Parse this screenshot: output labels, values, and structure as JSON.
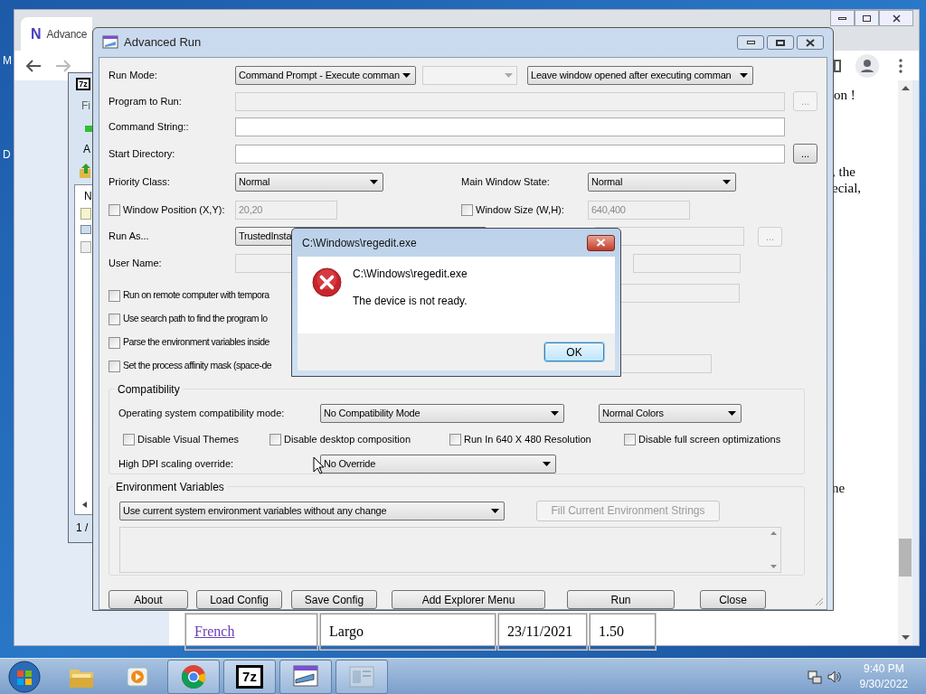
{
  "desktop": {
    "icon_labels": [
      "M",
      "D"
    ]
  },
  "browser": {
    "tab": {
      "favicon": "N",
      "title": "Advance"
    },
    "page_texts": [
      "on !",
      ", the",
      "ecial,",
      "ne"
    ],
    "table_row": [
      {
        "text": "French",
        "kind": "link"
      },
      {
        "text": "Largo",
        "kind": "text"
      },
      {
        "text": "23/11/2021",
        "kind": "text"
      },
      {
        "text": "1.50",
        "kind": "text"
      }
    ]
  },
  "archive_window": {
    "logo": "7z",
    "menu": "Fi",
    "toolbar_label": "A",
    "column_header": "N",
    "status": "1 /"
  },
  "main_window": {
    "title": "Advanced Run",
    "run_mode": {
      "label": "Run Mode:",
      "mode": "Command Prompt - Execute comman",
      "window_option": "Leave window opened after executing comman"
    },
    "program_to_run": {
      "label": "Program to Run:",
      "disabled": true,
      "browse": "...",
      "browse_disabled": true
    },
    "command_string": {
      "label": "Command String::"
    },
    "start_directory": {
      "label": "Start Directory:",
      "browse": "...",
      "browse_disabled": false
    },
    "priority_class": {
      "label": "Priority Class:",
      "value": "Normal"
    },
    "main_window_state": {
      "label": "Main Window State:",
      "value": "Normal"
    },
    "window_position": {
      "label": "Window Position (X,Y):",
      "checked": false,
      "value": "20,20"
    },
    "window_size": {
      "label": "Window Size (W,H):",
      "checked": false,
      "value": "640,400"
    },
    "run_as": {
      "label": "Run As...",
      "value": "TrustedInsta",
      "browse": "...",
      "browse_disabled": true
    },
    "user_name": {
      "label": "User Name:"
    },
    "options": [
      {
        "label": "Run on remote computer with tempora",
        "checked": false
      },
      {
        "label": "Use search path to find the program lo",
        "checked": false
      },
      {
        "label": "Parse the environment variables inside",
        "checked": false
      },
      {
        "label": "Set the process affinity mask (space-de",
        "checked": false
      }
    ],
    "compatibility": {
      "legend": "Compatibility",
      "os_label": "Operating system compatibility mode:",
      "os_mode": "No Compatibility Mode",
      "colors": "Normal Colors",
      "options": [
        {
          "label": "Disable Visual Themes",
          "checked": false
        },
        {
          "label": "Disable desktop composition",
          "checked": false
        },
        {
          "label": "Run In 640 X 480 Resolution",
          "checked": false
        },
        {
          "label": "Disable full screen optimizations",
          "checked": false
        }
      ],
      "dpi_label": "High DPI scaling override:",
      "dpi_value": "No Override"
    },
    "environment": {
      "legend": "Environment Variables",
      "mode": "Use current system environment variables without any change",
      "fill_button": {
        "label": "Fill Current Environment Strings",
        "disabled": true
      }
    },
    "buttons": [
      "About",
      "Load Config",
      "Save Config",
      "Add Explorer Menu",
      "Run",
      "Close"
    ]
  },
  "dialog": {
    "title": "C:\\Windows\\regedit.exe",
    "heading": "C:\\Windows\\regedit.exe",
    "message": "The device is not ready.",
    "button": "OK"
  },
  "taskbar": {
    "apps": [
      {
        "kind": "explorer",
        "active": false
      },
      {
        "kind": "media",
        "active": false
      },
      {
        "kind": "chrome",
        "active": true
      },
      {
        "kind": "archiver",
        "active": true,
        "label": "7z"
      },
      {
        "kind": "advanced-run",
        "active": true
      },
      {
        "kind": "window",
        "active": true
      }
    ],
    "time": "9:40 PM",
    "date": "9/30/2022"
  }
}
